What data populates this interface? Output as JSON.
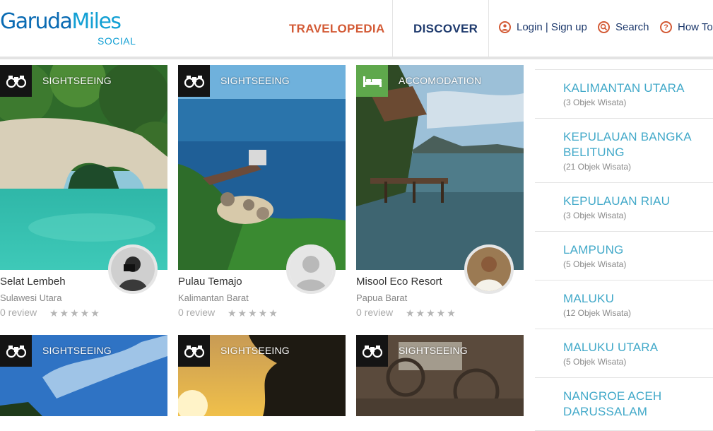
{
  "brand": {
    "name_part1": "Garuda",
    "name_part2": "Miles",
    "sub": "SOCIAL"
  },
  "nav": {
    "travelopedia": "TRAVELOPEDIA",
    "discover": "DISCOVER"
  },
  "header_links": {
    "login": "Login | Sign up",
    "search": "Search",
    "howto": "How To"
  },
  "colors": {
    "accent_orange": "#d35a35",
    "nav_blue": "#1e3a6d",
    "teal": "#42a9c9",
    "accommodation_green": "#5fa84c"
  },
  "cards": [
    {
      "category": "SIGHTSEEING",
      "category_icon": "binoculars-icon",
      "name": "Selat Lembeh",
      "region": "Sulawesi Utara",
      "review": "0 review",
      "stars": "★★★★★",
      "rating": 0
    },
    {
      "category": "SIGHTSEEING",
      "category_icon": "binoculars-icon",
      "name": "Pulau Temajo",
      "region": "Kalimantan Barat",
      "review": "0 review",
      "stars": "★★★★★",
      "rating": 0
    },
    {
      "category": "ACCOMODATION",
      "category_icon": "bed-icon",
      "name": "Misool Eco Resort",
      "region": "Papua Barat",
      "review": "0 review",
      "stars": "★★★★★",
      "rating": 0
    },
    {
      "category": "SIGHTSEEING",
      "category_icon": "binoculars-icon"
    },
    {
      "category": "SIGHTSEEING",
      "category_icon": "binoculars-icon"
    },
    {
      "category": "SIGHTSEEING",
      "category_icon": "binoculars-icon"
    }
  ],
  "provinces": [
    {
      "name": "KALIMANTAN UTARA",
      "count": "(3 Objek Wisata)"
    },
    {
      "name": "KEPULAUAN BANGKA BELITUNG",
      "count": "(21 Objek Wisata)"
    },
    {
      "name": "KEPULAUAN RIAU",
      "count": "(3 Objek Wisata)"
    },
    {
      "name": "LAMPUNG",
      "count": "(5 Objek Wisata)"
    },
    {
      "name": "MALUKU",
      "count": "(12 Objek Wisata)"
    },
    {
      "name": "MALUKU UTARA",
      "count": "(5 Objek Wisata)"
    },
    {
      "name": "NANGROE ACEH DARUSSALAM",
      "count": ""
    }
  ]
}
